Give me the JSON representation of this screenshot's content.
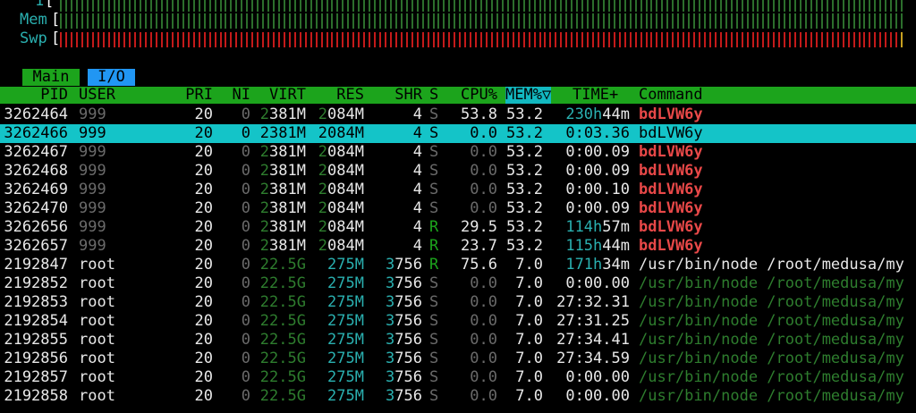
{
  "meters": [
    {
      "label": "1",
      "bar_color": "#2c6e2c",
      "bar_count": 159
    },
    {
      "label": "Mem",
      "bar_color": "#2c6e2c",
      "bar_count": 159
    },
    {
      "label": "Swp",
      "bar_color": "#c41a1a",
      "bar_count": 159,
      "tail_color": "#c8a020"
    }
  ],
  "bracket_open": "[",
  "tabs": [
    {
      "label": "Main",
      "active": true
    },
    {
      "label": "I/O",
      "active": false
    }
  ],
  "columns": {
    "pid": "PID",
    "user": "USER",
    "pri": "PRI",
    "ni": "NI",
    "virt": "VIRT",
    "res": "RES",
    "shr": "SHR",
    "s": "S",
    "cpu": "CPU%",
    "mem": "MEM%▽",
    "time": "TIME+",
    "command": "Command"
  },
  "colors": {
    "dim": "#6a6a6a",
    "cyan": "#2ab0b0",
    "green": "#1ca41c",
    "dark_green": "#2e7d2e",
    "red_bold": "#e84848",
    "tab_active_bg": "#1ca41c",
    "tab_inactive_bg": "#2196f3",
    "selected_bg": "#14c4c8"
  },
  "processes": [
    {
      "pid": "3262464",
      "user": "999",
      "pri": "20",
      "ni": "0",
      "virt_a": "2",
      "virt_b": "381M",
      "res_a": "2",
      "res_b": "084M",
      "shr_a": "",
      "shr_b": "4",
      "s": "S",
      "cpu": "53.8",
      "mem": "53.2",
      "time_a": "230h",
      "time_b": "44m",
      "cmd": "bdLVW6y",
      "style": "thread-hot"
    },
    {
      "pid": "3262466",
      "user": "999",
      "pri": "20",
      "ni": "0",
      "virt_a": "2",
      "virt_b": "381M",
      "res_a": "2",
      "res_b": "084M",
      "shr_a": "",
      "shr_b": "4",
      "s": "S",
      "cpu": "0.0",
      "mem": "53.2",
      "time_a": "",
      "time_b": "0:03.36",
      "cmd": "bdLVW6y",
      "style": "selected"
    },
    {
      "pid": "3262467",
      "user": "999",
      "pri": "20",
      "ni": "0",
      "virt_a": "2",
      "virt_b": "381M",
      "res_a": "2",
      "res_b": "084M",
      "shr_a": "",
      "shr_b": "4",
      "s": "S",
      "cpu": "0.0",
      "mem": "53.2",
      "time_a": "",
      "time_b": "0:00.09",
      "cmd": "bdLVW6y",
      "style": "thread"
    },
    {
      "pid": "3262468",
      "user": "999",
      "pri": "20",
      "ni": "0",
      "virt_a": "2",
      "virt_b": "381M",
      "res_a": "2",
      "res_b": "084M",
      "shr_a": "",
      "shr_b": "4",
      "s": "S",
      "cpu": "0.0",
      "mem": "53.2",
      "time_a": "",
      "time_b": "0:00.09",
      "cmd": "bdLVW6y",
      "style": "thread"
    },
    {
      "pid": "3262469",
      "user": "999",
      "pri": "20",
      "ni": "0",
      "virt_a": "2",
      "virt_b": "381M",
      "res_a": "2",
      "res_b": "084M",
      "shr_a": "",
      "shr_b": "4",
      "s": "S",
      "cpu": "0.0",
      "mem": "53.2",
      "time_a": "",
      "time_b": "0:00.10",
      "cmd": "bdLVW6y",
      "style": "thread"
    },
    {
      "pid": "3262470",
      "user": "999",
      "pri": "20",
      "ni": "0",
      "virt_a": "2",
      "virt_b": "381M",
      "res_a": "2",
      "res_b": "084M",
      "shr_a": "",
      "shr_b": "4",
      "s": "S",
      "cpu": "0.0",
      "mem": "53.2",
      "time_a": "",
      "time_b": "0:00.09",
      "cmd": "bdLVW6y",
      "style": "thread"
    },
    {
      "pid": "3262656",
      "user": "999",
      "pri": "20",
      "ni": "0",
      "virt_a": "2",
      "virt_b": "381M",
      "res_a": "2",
      "res_b": "084M",
      "shr_a": "",
      "shr_b": "4",
      "s": "R",
      "cpu": "29.5",
      "mem": "53.2",
      "time_a": "114h",
      "time_b": "57m",
      "cmd": "bdLVW6y",
      "style": "thread-hot"
    },
    {
      "pid": "3262657",
      "user": "999",
      "pri": "20",
      "ni": "0",
      "virt_a": "2",
      "virt_b": "381M",
      "res_a": "2",
      "res_b": "084M",
      "shr_a": "",
      "shr_b": "4",
      "s": "R",
      "cpu": "23.7",
      "mem": "53.2",
      "time_a": "115h",
      "time_b": "44m",
      "cmd": "bdLVW6y",
      "style": "thread-hot"
    },
    {
      "pid": "2192847",
      "user": "root",
      "pri": "20",
      "ni": "0",
      "virt_a": "22.5",
      "virt_b": "G",
      "res_a": "",
      "res_b": "275M",
      "shr_a": "3",
      "shr_b": "756",
      "s": "R",
      "cpu": "75.6",
      "mem": "7.0",
      "time_a": "171h",
      "time_b": "34m",
      "cmd": "/usr/bin/node /root/medusa/my",
      "style": "main"
    },
    {
      "pid": "2192852",
      "user": "root",
      "pri": "20",
      "ni": "0",
      "virt_a": "22.5",
      "virt_b": "G",
      "res_a": "",
      "res_b": "275M",
      "shr_a": "3",
      "shr_b": "756",
      "s": "S",
      "cpu": "0.0",
      "mem": "7.0",
      "time_a": "",
      "time_b": "0:00.00",
      "cmd": "/usr/bin/node /root/medusa/my",
      "style": "nodethread"
    },
    {
      "pid": "2192853",
      "user": "root",
      "pri": "20",
      "ni": "0",
      "virt_a": "22.5",
      "virt_b": "G",
      "res_a": "",
      "res_b": "275M",
      "shr_a": "3",
      "shr_b": "756",
      "s": "S",
      "cpu": "0.0",
      "mem": "7.0",
      "time_a": "",
      "time_b": "27:32.31",
      "cmd": "/usr/bin/node /root/medusa/my",
      "style": "nodethread"
    },
    {
      "pid": "2192854",
      "user": "root",
      "pri": "20",
      "ni": "0",
      "virt_a": "22.5",
      "virt_b": "G",
      "res_a": "",
      "res_b": "275M",
      "shr_a": "3",
      "shr_b": "756",
      "s": "S",
      "cpu": "0.0",
      "mem": "7.0",
      "time_a": "",
      "time_b": "27:31.25",
      "cmd": "/usr/bin/node /root/medusa/my",
      "style": "nodethread"
    },
    {
      "pid": "2192855",
      "user": "root",
      "pri": "20",
      "ni": "0",
      "virt_a": "22.5",
      "virt_b": "G",
      "res_a": "",
      "res_b": "275M",
      "shr_a": "3",
      "shr_b": "756",
      "s": "S",
      "cpu": "0.0",
      "mem": "7.0",
      "time_a": "",
      "time_b": "27:34.41",
      "cmd": "/usr/bin/node /root/medusa/my",
      "style": "nodethread"
    },
    {
      "pid": "2192856",
      "user": "root",
      "pri": "20",
      "ni": "0",
      "virt_a": "22.5",
      "virt_b": "G",
      "res_a": "",
      "res_b": "275M",
      "shr_a": "3",
      "shr_b": "756",
      "s": "S",
      "cpu": "0.0",
      "mem": "7.0",
      "time_a": "",
      "time_b": "27:34.59",
      "cmd": "/usr/bin/node /root/medusa/my",
      "style": "nodethread"
    },
    {
      "pid": "2192857",
      "user": "root",
      "pri": "20",
      "ni": "0",
      "virt_a": "22.5",
      "virt_b": "G",
      "res_a": "",
      "res_b": "275M",
      "shr_a": "3",
      "shr_b": "756",
      "s": "S",
      "cpu": "0.0",
      "mem": "7.0",
      "time_a": "",
      "time_b": "0:00.00",
      "cmd": "/usr/bin/node /root/medusa/my",
      "style": "nodethread"
    },
    {
      "pid": "2192858",
      "user": "root",
      "pri": "20",
      "ni": "0",
      "virt_a": "22.5",
      "virt_b": "G",
      "res_a": "",
      "res_b": "275M",
      "shr_a": "3",
      "shr_b": "756",
      "s": "S",
      "cpu": "0.0",
      "mem": "7.0",
      "time_a": "",
      "time_b": "0:00.00",
      "cmd": "/usr/bin/node /root/medusa/my",
      "style": "nodethread"
    }
  ]
}
